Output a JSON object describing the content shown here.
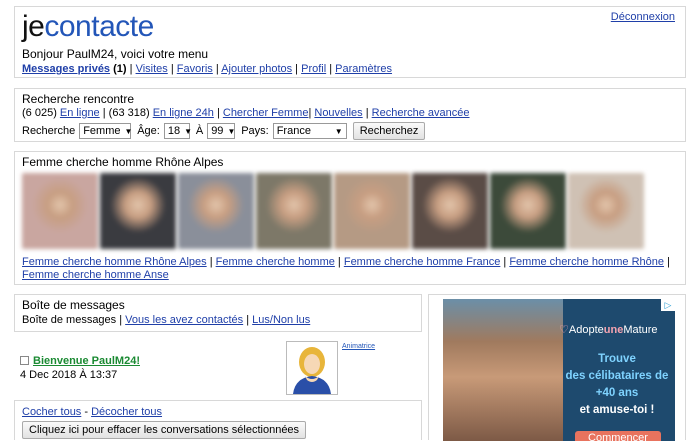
{
  "header": {
    "logo_part1": "je",
    "logo_part2": "contacte",
    "greeting": "Bonjour PaulM24, voici votre menu",
    "logout": "Déconnexion",
    "menu": {
      "messages": "Messages privés",
      "messages_count": "(1)",
      "visits": "Visites",
      "favorites": "Favoris",
      "add_photos": "Ajouter photos",
      "profile": "Profil",
      "settings": "Paramètres"
    }
  },
  "search": {
    "title": "Recherche rencontre",
    "online_count": "(6 025)",
    "online_label": "En ligne",
    "online24_count": "(63 318)",
    "online24_label": "En ligne 24h",
    "search_woman": "Chercher Femme",
    "new": "Nouvelles",
    "advanced": "Recherche avancée",
    "form": {
      "search_label": "Recherche",
      "gender_value": "Femme",
      "age_label": "Âge:",
      "age_min": "18",
      "age_sep": "À",
      "age_max": "99",
      "country_label": "Pays:",
      "country_value": "France",
      "submit": "Recherchez"
    }
  },
  "gallery": {
    "title": "Femme cherche homme Rhône Alpes",
    "thumb_colors": [
      "#c9a6a0",
      "#3a3b40",
      "#8a8f9a",
      "#7d7868",
      "#b59a84",
      "#5a4c46",
      "#3c4a3a",
      "#cfc1b4"
    ],
    "links": [
      "Femme cherche homme Rhône Alpes",
      "Femme cherche homme",
      "Femme cherche homme France",
      "Femme cherche homme Rhône",
      "Femme cherche homme Anse"
    ]
  },
  "messages": {
    "title": "Boîte de messages",
    "inbox_label": "Boîte de messages",
    "contacted": "Vous les avez contactés",
    "read_unread": "Lus/Non lus",
    "item": {
      "subject": "Bienvenue PaulM24!",
      "date": "4 Dec 2018 À 13:37",
      "sender_label": "Animatrice"
    },
    "check_all": "Cocher tous",
    "uncheck_all": "Décocher tous",
    "delete_button": "Cliquez ici pour effacer les conversations sélectionnées"
  },
  "ad": {
    "brand_part1": "Adopte",
    "brand_part2": "une",
    "brand_part3": "Mature",
    "line1": "Trouve",
    "line2": "des célibataires de +40 ans",
    "line3": "et amuse-toi !",
    "cta": "Commencer",
    "choices": "▷"
  }
}
